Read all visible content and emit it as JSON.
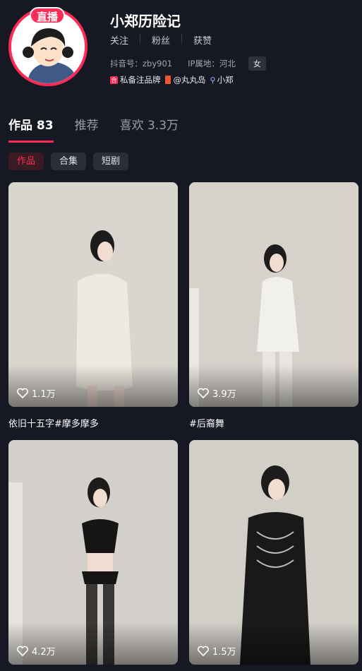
{
  "profile": {
    "live_badge": "直播",
    "nickname": "小郑历险记",
    "stats": {
      "following": "关注",
      "followers": "粉丝",
      "likes": "获赞"
    },
    "douyin_id": "抖音号：zby901",
    "ip_location": "IP属地：河北",
    "gender": "女",
    "links": {
      "shop": "私备注品牌",
      "room": "@丸丸岛",
      "search": "小郑"
    }
  },
  "tabs": [
    {
      "label": "作品 83"
    },
    {
      "label": "推荐"
    },
    {
      "label": "喜欢 3.3万"
    }
  ],
  "chips": [
    {
      "label": "作品"
    },
    {
      "label": "合集"
    },
    {
      "label": "短剧"
    }
  ],
  "videos": [
    {
      "likes": "1.1万",
      "caption": "依旧十五字#摩多摩多"
    },
    {
      "likes": "3.9万",
      "caption": "#后裔舞"
    },
    {
      "likes": "4.2万",
      "caption": ""
    },
    {
      "likes": "1.5万",
      "caption": ""
    }
  ],
  "colors": {
    "accent": "#fe2c55",
    "background": "#161823"
  }
}
